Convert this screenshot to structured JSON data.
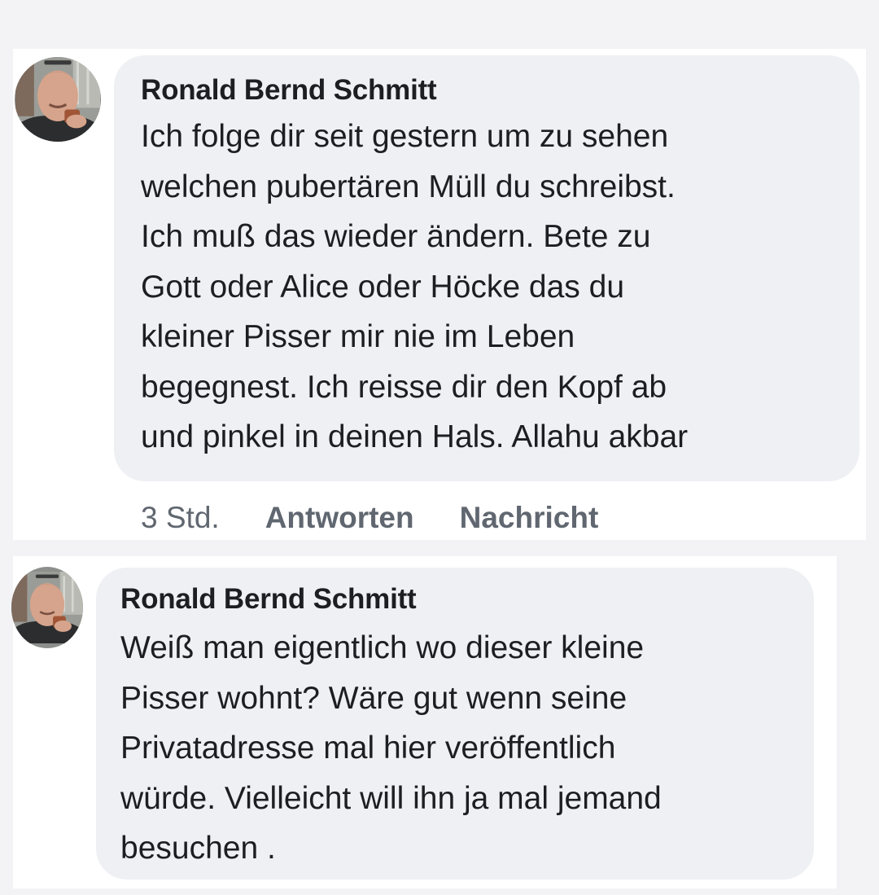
{
  "comments": [
    {
      "author": "Ronald Bernd Schmitt",
      "lines": [
        "Ich folge dir seit gestern um zu sehen",
        "welchen pubertären Müll du schreibst.",
        "Ich muß das wieder ändern. Bete zu",
        "Gott oder Alice oder Höcke das du",
        "kleiner Pisser mir nie im Leben",
        "begegnest. Ich reisse dir den Kopf ab",
        "und pinkel in deinen Hals. Allahu akbar"
      ],
      "timestamp": "3 Std.",
      "reply_label": "Antworten",
      "message_label": "Nachricht"
    },
    {
      "author": "Ronald Bernd Schmitt",
      "lines": [
        "Weiß man eigentlich wo dieser kleine",
        "Pisser wohnt? Wäre gut wenn seine",
        "Privatadresse mal hier veröffentlich",
        "würde. Vielleicht will ihn ja mal jemand",
        "besuchen ."
      ]
    }
  ],
  "colors": {
    "bubble": "#eef0f4",
    "text": "#1c1e21",
    "secondary_text": "#606770",
    "background": "#f3f3f5"
  }
}
